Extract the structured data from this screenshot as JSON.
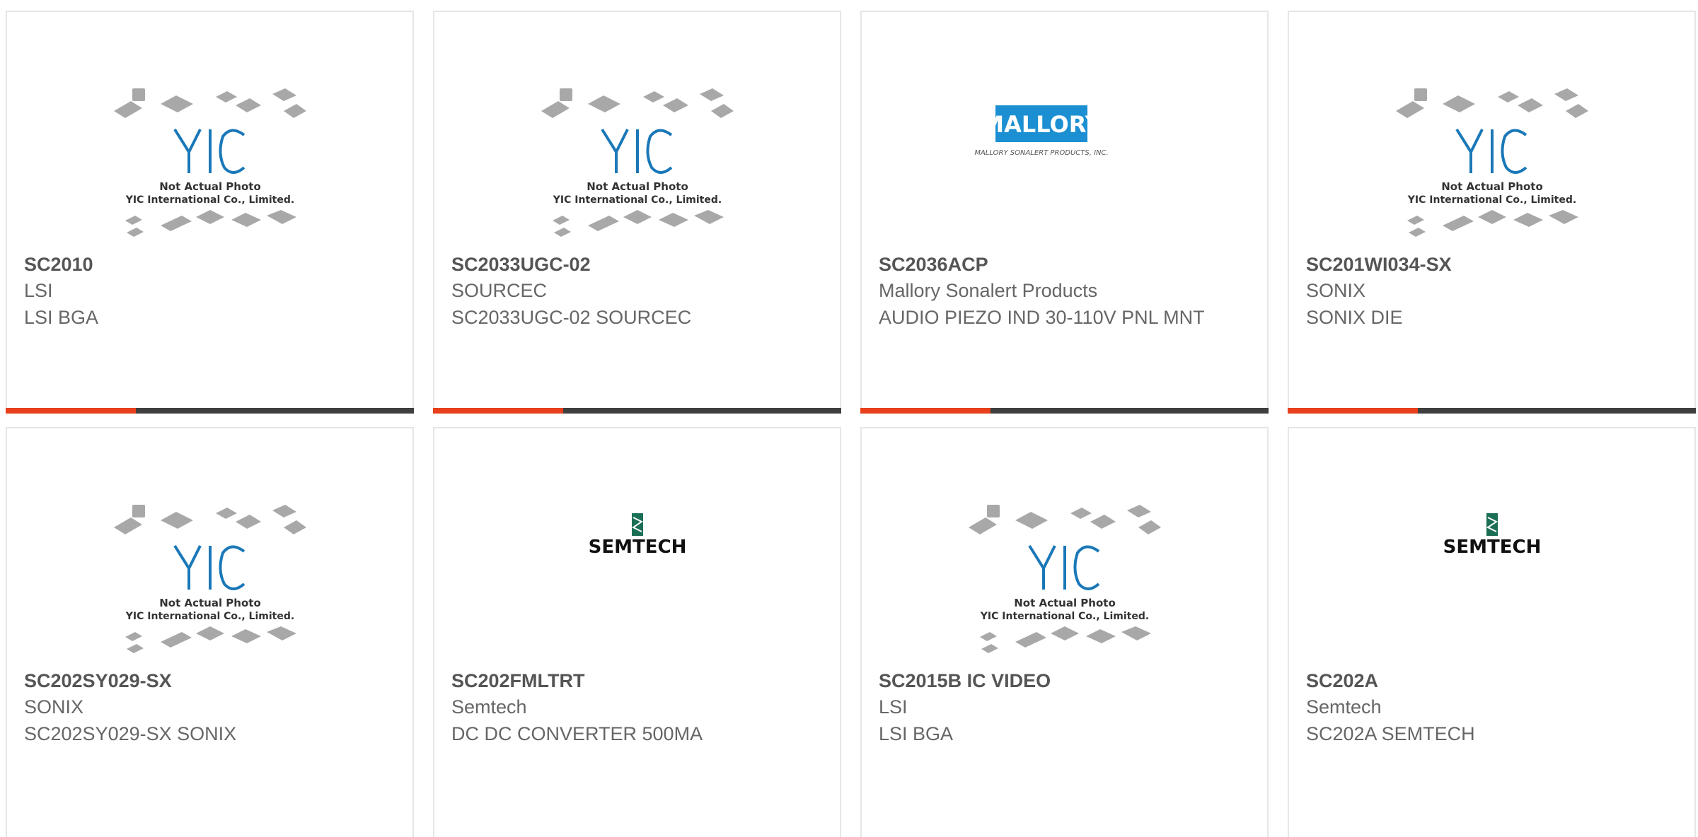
{
  "colors": {
    "accent": "#e8401c",
    "bar": "#3f3f3f",
    "yic_blue": "#1a78b8",
    "semtech_green": "#1a6e55",
    "mallory_blue": "#1b8fd2"
  },
  "cards": [
    {
      "part_number": "SC2010",
      "manufacturer": "LSI",
      "description": "LSI BGA",
      "image": "yic-placeholder",
      "yic_line1": "Not Actual Photo",
      "yic_line2": "YIC International Co., Limited."
    },
    {
      "part_number": "SC2033UGC-02",
      "manufacturer": "SOURCEC",
      "description": "SC2033UGC-02 SOURCEC",
      "image": "yic-placeholder",
      "yic_line1": "Not Actual Photo",
      "yic_line2": "YIC International Co., Limited."
    },
    {
      "part_number": "SC2036ACP",
      "manufacturer": "Mallory Sonalert Products",
      "description": "AUDIO PIEZO IND 30-110V PNL MNT",
      "image": "mallory-logo",
      "logo_text": "MALLORY",
      "logo_subtext": "MALLORY SONALERT PRODUCTS, INC."
    },
    {
      "part_number": "SC201WI034-SX",
      "manufacturer": "SONIX",
      "description": "SONIX DIE",
      "image": "yic-placeholder",
      "yic_line1": "Not Actual Photo",
      "yic_line2": "YIC International Co., Limited."
    },
    {
      "part_number": "SC202SY029-SX",
      "manufacturer": "SONIX",
      "description": "SC202SY029-SX SONIX",
      "image": "yic-placeholder",
      "yic_line1": "Not Actual Photo",
      "yic_line2": "YIC International Co., Limited."
    },
    {
      "part_number": "SC202FMLTRT",
      "manufacturer": "Semtech",
      "description": "DC DC CONVERTER 500MA",
      "image": "semtech-logo",
      "logo_text": "SEMTECH"
    },
    {
      "part_number": "SC2015B IC VIDEO",
      "manufacturer": "LSI",
      "description": "LSI BGA",
      "image": "yic-placeholder",
      "yic_line1": "Not Actual Photo",
      "yic_line2": "YIC International Co., Limited."
    },
    {
      "part_number": "SC202A",
      "manufacturer": "Semtech",
      "description": "SC202A SEMTECH",
      "image": "semtech-logo",
      "logo_text": "SEMTECH"
    }
  ]
}
